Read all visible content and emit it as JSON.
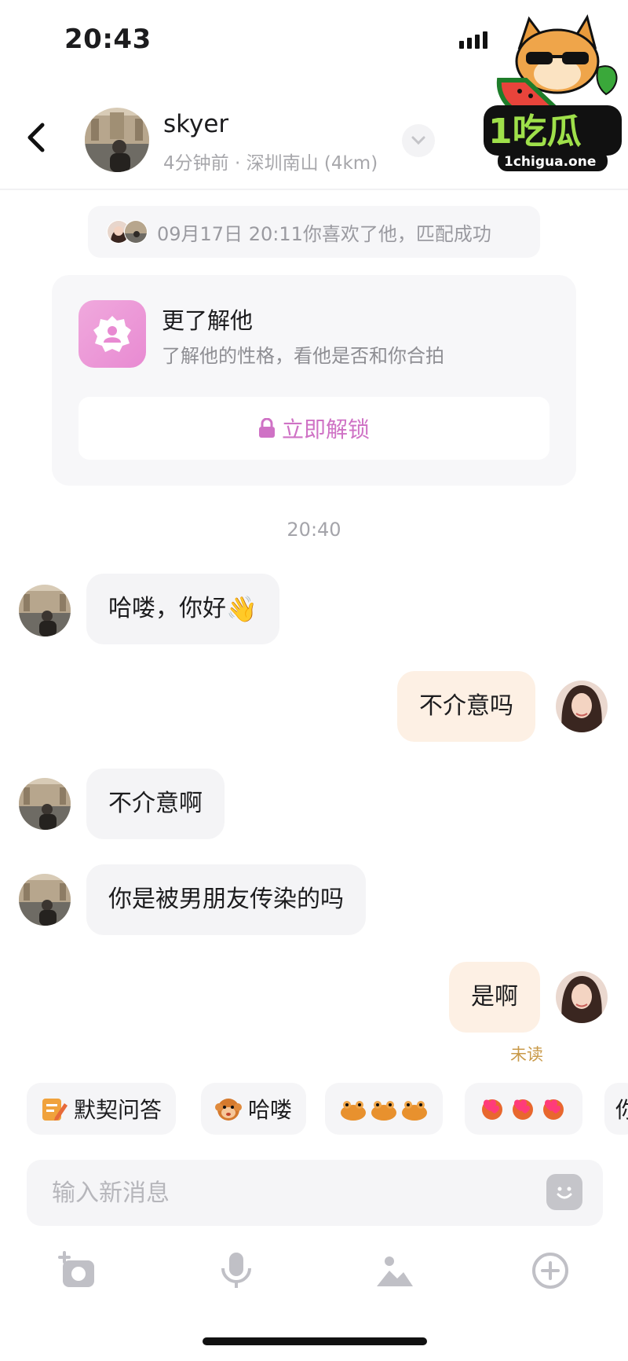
{
  "status_bar": {
    "time": "20:43"
  },
  "watermark": {
    "brand": "1吃瓜",
    "domain": "1chigua.one"
  },
  "header": {
    "name": "skyer",
    "subtitle": "4分钟前 · 深圳南山 (4km)"
  },
  "match_notice": {
    "text": "09月17日 20:11你喜欢了他，匹配成功"
  },
  "card": {
    "title": "更了解他",
    "subtitle": "了解他的性格，看他是否和你合拍",
    "button": "立即解锁"
  },
  "time_separator": "20:40",
  "messages": [
    {
      "side": "in",
      "text": "哈喽，你好",
      "emoji": "👋"
    },
    {
      "side": "out",
      "text": "不介意吗"
    },
    {
      "side": "in",
      "text": "不介意啊"
    },
    {
      "side": "in",
      "text": "你是被男朋友传染的吗"
    },
    {
      "side": "out",
      "text": "是啊",
      "status": "未读"
    }
  ],
  "quick_replies": [
    "默契问答",
    "哈喽",
    "",
    "",
    "你"
  ],
  "input": {
    "placeholder": "输入新消息"
  },
  "colors": {
    "accent_pink": "#cf72c5",
    "out_bubble": "#fdf0e4",
    "in_bubble": "#f4f4f6",
    "unread": "#c99a4a"
  },
  "icons": {
    "back": "chevron-left-icon",
    "dropdown": "chevron-down-icon",
    "card": "badge-user-icon",
    "lock": "lock-icon",
    "emoji": "smiley-icon",
    "camera": "camera-icon",
    "mic": "mic-icon",
    "image": "image-icon",
    "add": "plus-circle-icon"
  }
}
